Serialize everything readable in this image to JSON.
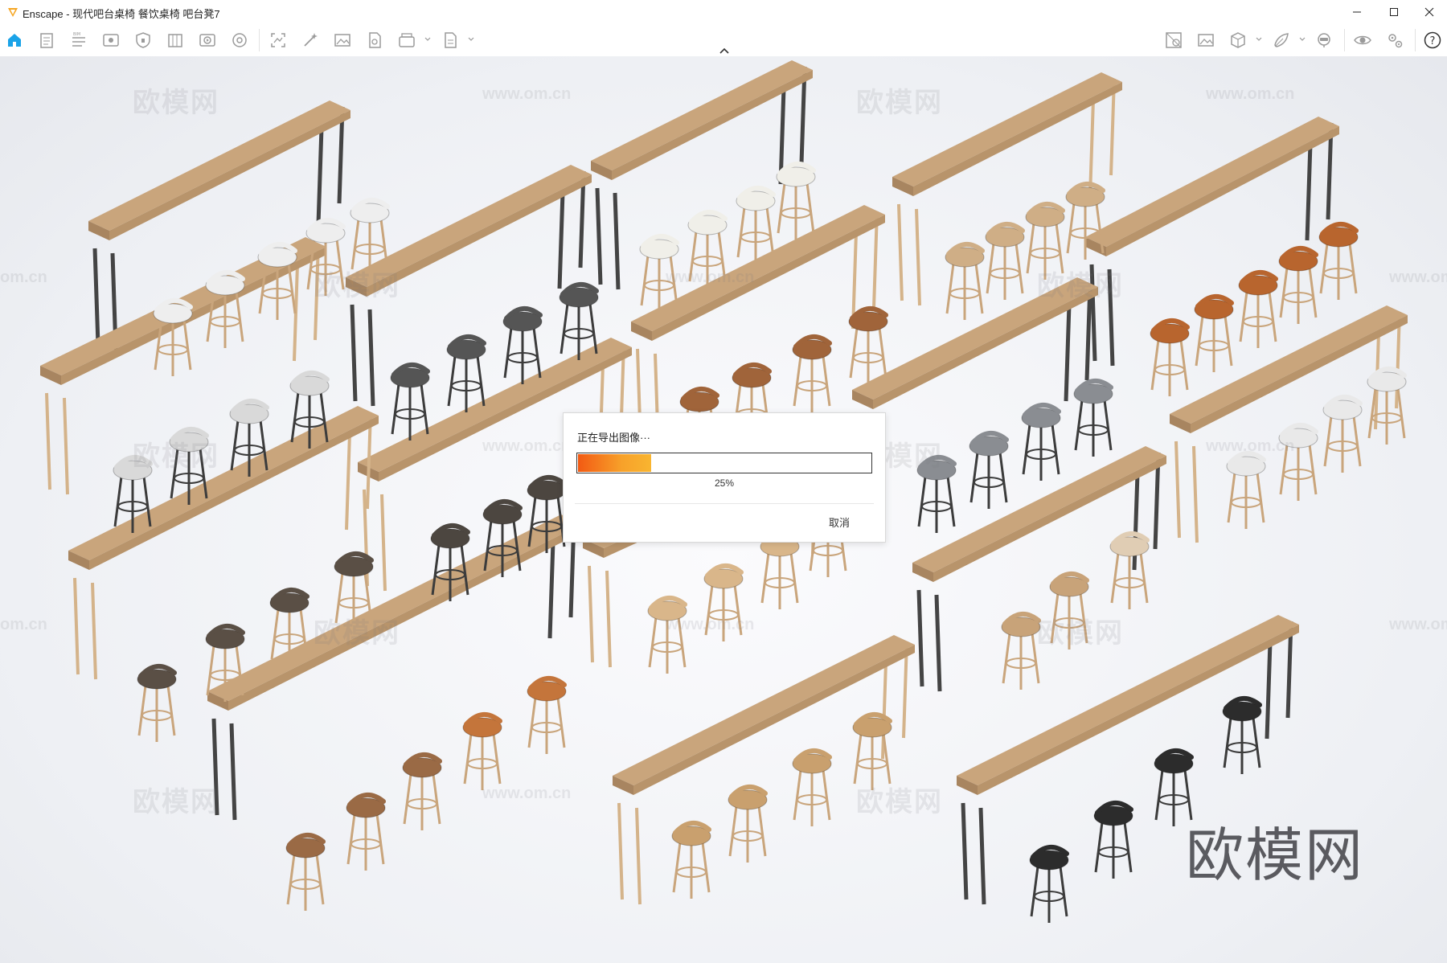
{
  "window": {
    "app_name": "Enscape",
    "title": "Enscape - 现代吧台桌椅 餐饮桌椅 吧台凳7",
    "controls": [
      "minimize",
      "maximize",
      "close"
    ]
  },
  "toolbar": {
    "left_icons": [
      "home-icon",
      "document-icon",
      "bim-icon",
      "view-icon",
      "safe-icon",
      "library-icon",
      "video-icon",
      "panorama-icon",
      "capture-icon",
      "effects-icon",
      "screenshot-icon",
      "export-file-icon",
      "batch-render-icon",
      "export-doc-icon"
    ],
    "right_icons": [
      "material-editor-icon",
      "image-icon",
      "asset-icon",
      "vr-icon",
      "presence-icon",
      "visual-settings-icon",
      "settings-icon",
      "help-icon"
    ],
    "help_label": "?"
  },
  "viewport": {
    "watermark_brand": "欧模网",
    "watermark_url": "www.om.cn",
    "watermark_url_short": "om.cn"
  },
  "export_dialog": {
    "title": "正在导出图像···",
    "progress_percent_label": "25%",
    "progress": 0.25,
    "cancel_label": "取消",
    "accent": "#f25a13"
  },
  "colors": {
    "wood_top": "#c9a57c",
    "wood_leg": "#d4b38a",
    "metal": "#444444",
    "brand_icon": "#1aa3e8"
  }
}
